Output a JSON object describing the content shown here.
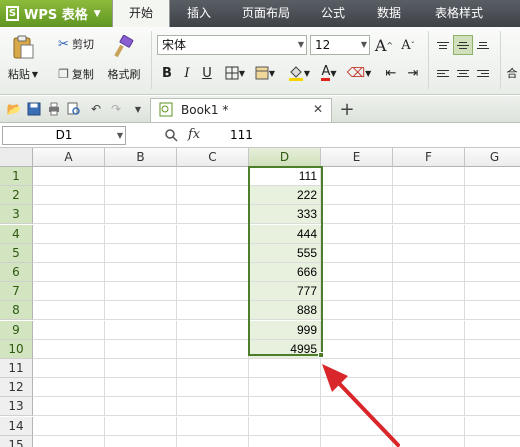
{
  "app": {
    "name": "WPS 表格",
    "logo_letter": "S"
  },
  "menu": {
    "tabs": [
      {
        "label": "开始",
        "active": true
      },
      {
        "label": "插入"
      },
      {
        "label": "页面布局"
      },
      {
        "label": "公式"
      },
      {
        "label": "数据"
      },
      {
        "label": "表格样式"
      }
    ]
  },
  "ribbon": {
    "paste_label": "粘贴",
    "cut_label": "剪切",
    "copy_label": "复制",
    "format_painter_label": "格式刷",
    "font_name": "宋体",
    "font_size": "12",
    "bold": "B",
    "italic": "I",
    "underline": "U",
    "grow_font": "A",
    "shrink_font": "A",
    "font_color": "A",
    "merge_partial": "合"
  },
  "toolbar": {
    "document_tab": "Book1 *",
    "new_tab": "+",
    "close_tab": "✕"
  },
  "formula_bar": {
    "cell_ref": "D1",
    "fx_label": "fx",
    "value": "111"
  },
  "sheet": {
    "columns": [
      "A",
      "B",
      "C",
      "D",
      "E",
      "F",
      "G"
    ],
    "selected_column": "D",
    "rows": [
      "1",
      "2",
      "3",
      "4",
      "5",
      "6",
      "7",
      "8",
      "9",
      "10",
      "11",
      "12",
      "13",
      "14",
      "15"
    ],
    "column_d_values": [
      "111",
      "222",
      "333",
      "444",
      "555",
      "666",
      "777",
      "888",
      "999",
      "4995"
    ]
  },
  "colors": {
    "accent_green": "#5f9622",
    "selection_border": "#4d7f2a",
    "selection_fill": "#e8f1de",
    "annotation_arrow": "#d9262b"
  }
}
